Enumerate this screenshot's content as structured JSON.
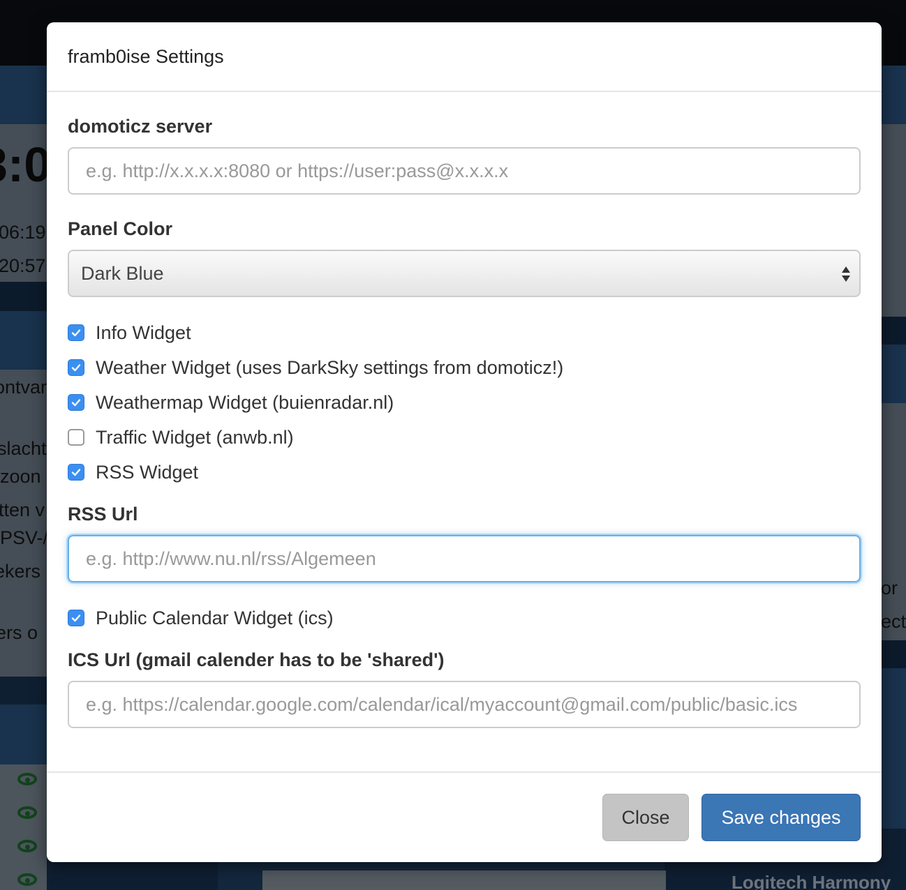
{
  "background": {
    "clock_fragment": "3:0",
    "side_texts": [
      "06:19",
      "20:57",
      "ontvar",
      "slacht",
      "zoon",
      "tten v",
      "PSV-/",
      "ekers",
      "ers o"
    ],
    "right_texts": [
      "or",
      "ect"
    ],
    "footer_text": "Logitech Harmony"
  },
  "modal": {
    "title": "framb0ise Settings",
    "server": {
      "label": "domoticz server",
      "placeholder": "e.g. http://x.x.x.x:8080 or https://user:pass@x.x.x.x",
      "value": ""
    },
    "panel_color": {
      "label": "Panel Color",
      "selected": "Dark Blue"
    },
    "widgets": [
      {
        "label": "Info Widget",
        "checked": true
      },
      {
        "label": "Weather Widget (uses DarkSky settings from domoticz!)",
        "checked": true
      },
      {
        "label": "Weathermap Widget (buienradar.nl)",
        "checked": true
      },
      {
        "label": "Traffic Widget (anwb.nl)",
        "checked": false
      },
      {
        "label": "RSS Widget",
        "checked": true
      }
    ],
    "rss": {
      "label": "RSS Url",
      "placeholder": "e.g. http://www.nu.nl/rss/Algemeen",
      "value": ""
    },
    "calendar_widget": {
      "label": "Public Calendar Widget (ics)",
      "checked": true
    },
    "ics": {
      "label": "ICS Url (gmail calender has to be 'shared')",
      "placeholder": "e.g. https://calendar.google.com/calendar/ical/myaccount@gmail.com/public/basic.ics",
      "value": ""
    },
    "buttons": {
      "close": "Close",
      "save": "Save changes"
    }
  },
  "colors": {
    "accent": "#3b8ff0",
    "primary_button": "#3b76b5",
    "secondary_button": "#c4c4c4",
    "focus_border": "#66afe9"
  }
}
